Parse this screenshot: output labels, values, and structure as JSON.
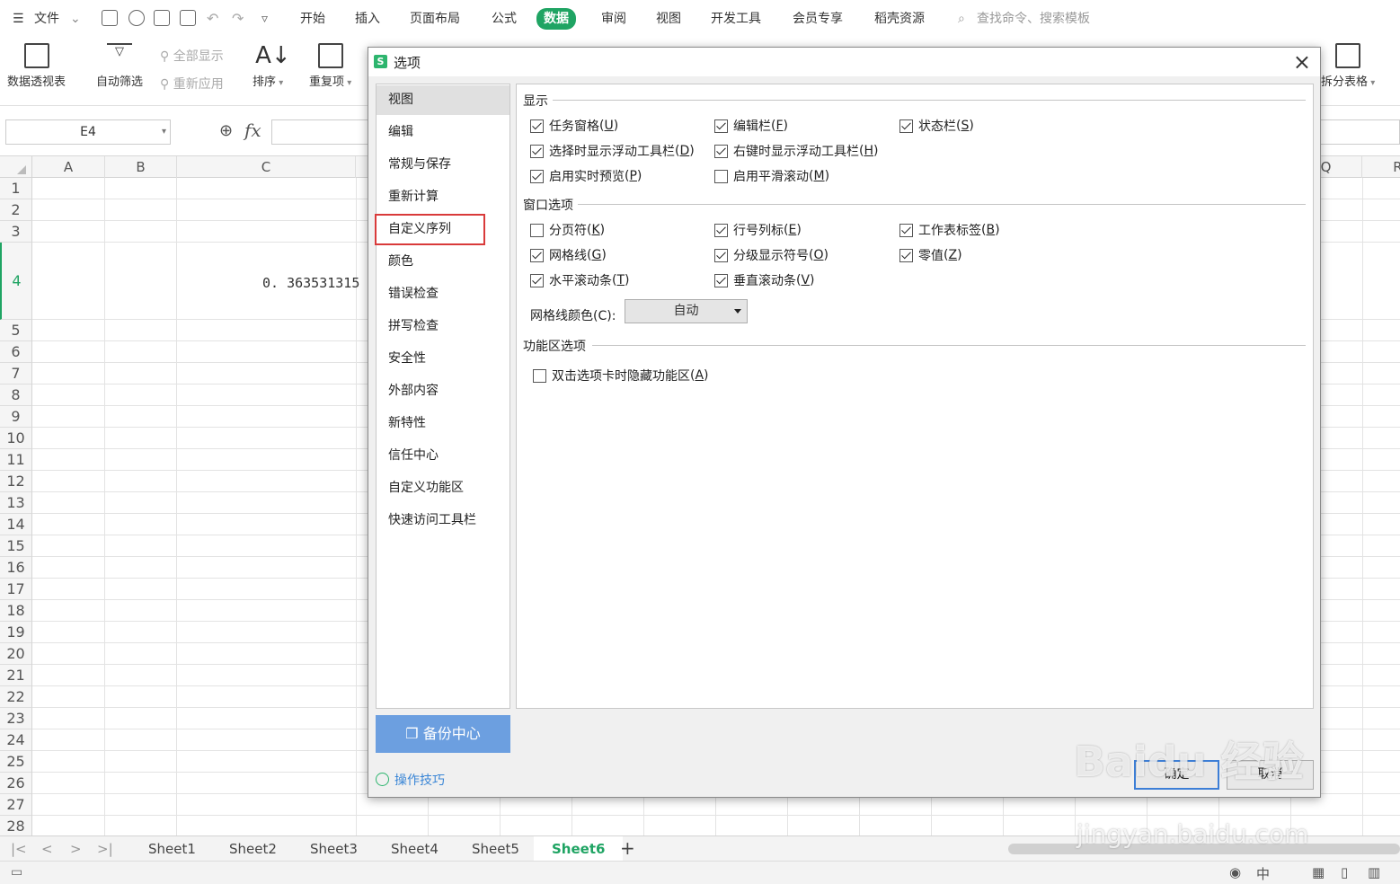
{
  "menubar": {
    "file": "文件",
    "tabs": [
      "开始",
      "插入",
      "页面布局",
      "公式",
      "数据",
      "审阅",
      "视图",
      "开发工具",
      "会员专享",
      "稻壳资源"
    ],
    "active_tab": "数据",
    "search": "查找命令、搜索模板"
  },
  "ribbon": {
    "pivot": "数据透视表",
    "autofilter": "自动筛选",
    "show_all": "全部显示",
    "reapply": "重新应用",
    "sort": "排序",
    "duplicates": "重复项",
    "split_table": "拆分表格"
  },
  "formula_bar": {
    "name_box": "E4",
    "fx": "fx"
  },
  "grid": {
    "columns": [
      "A",
      "B",
      "C",
      "Q",
      "R"
    ],
    "rows": [
      "1",
      "2",
      "3",
      "4",
      "5",
      "6",
      "7",
      "8",
      "9",
      "10",
      "11",
      "12",
      "13",
      "14",
      "15",
      "16",
      "17",
      "18",
      "19",
      "20",
      "21",
      "22",
      "23",
      "24",
      "25",
      "26",
      "27",
      "28"
    ],
    "cell_c4": "0. 363531315"
  },
  "sheets": [
    "Sheet1",
    "Sheet2",
    "Sheet3",
    "Sheet4",
    "Sheet5",
    "Sheet6"
  ],
  "active_sheet": "Sheet6",
  "status": {
    "input_mode": "中"
  },
  "dialog": {
    "title": "选项",
    "logo": "S",
    "nav": [
      "视图",
      "编辑",
      "常规与保存",
      "重新计算",
      "自定义序列",
      "颜色",
      "错误检查",
      "拼写检查",
      "安全性",
      "外部内容",
      "新特性",
      "信任中心",
      "自定义功能区",
      "快速访问工具栏"
    ],
    "selected_nav": "视图",
    "highlighted_nav": "自定义序列",
    "backup": "备份中心",
    "tips": "操作技巧",
    "sections": {
      "display": {
        "title": "显示",
        "options": [
          {
            "label": "任务窗格",
            "key": "U",
            "checked": true
          },
          {
            "label": "编辑栏",
            "key": "F",
            "checked": true
          },
          {
            "label": "状态栏",
            "key": "S",
            "checked": true
          },
          {
            "label": "选择时显示浮动工具栏",
            "key": "D",
            "checked": true
          },
          {
            "label": "右键时显示浮动工具栏",
            "key": "H",
            "checked": true
          },
          {
            "label": "启用实时预览",
            "key": "P",
            "checked": true
          },
          {
            "label": "启用平滑滚动",
            "key": "M",
            "checked": false
          }
        ]
      },
      "window": {
        "title": "窗口选项",
        "options": [
          {
            "label": "分页符",
            "key": "K",
            "checked": false
          },
          {
            "label": "行号列标",
            "key": "E",
            "checked": true
          },
          {
            "label": "工作表标签",
            "key": "B",
            "checked": true
          },
          {
            "label": "网格线",
            "key": "G",
            "checked": true
          },
          {
            "label": "分级显示符号",
            "key": "O",
            "checked": true
          },
          {
            "label": "零值",
            "key": "Z",
            "checked": true
          },
          {
            "label": "水平滚动条",
            "key": "T",
            "checked": true
          },
          {
            "label": "垂直滚动条",
            "key": "V",
            "checked": true
          }
        ],
        "gridline_color_label": "网格线颜色(C):",
        "gridline_color_value": "自动"
      },
      "ribbon": {
        "title": "功能区选项",
        "options": [
          {
            "label": "双击选项卡时隐藏功能区",
            "key": "A",
            "checked": false
          }
        ]
      }
    },
    "ok": "确定",
    "cancel": "取消"
  },
  "watermark": {
    "brand": "Baidu 经验",
    "url": "jingyan.baidu.com"
  }
}
